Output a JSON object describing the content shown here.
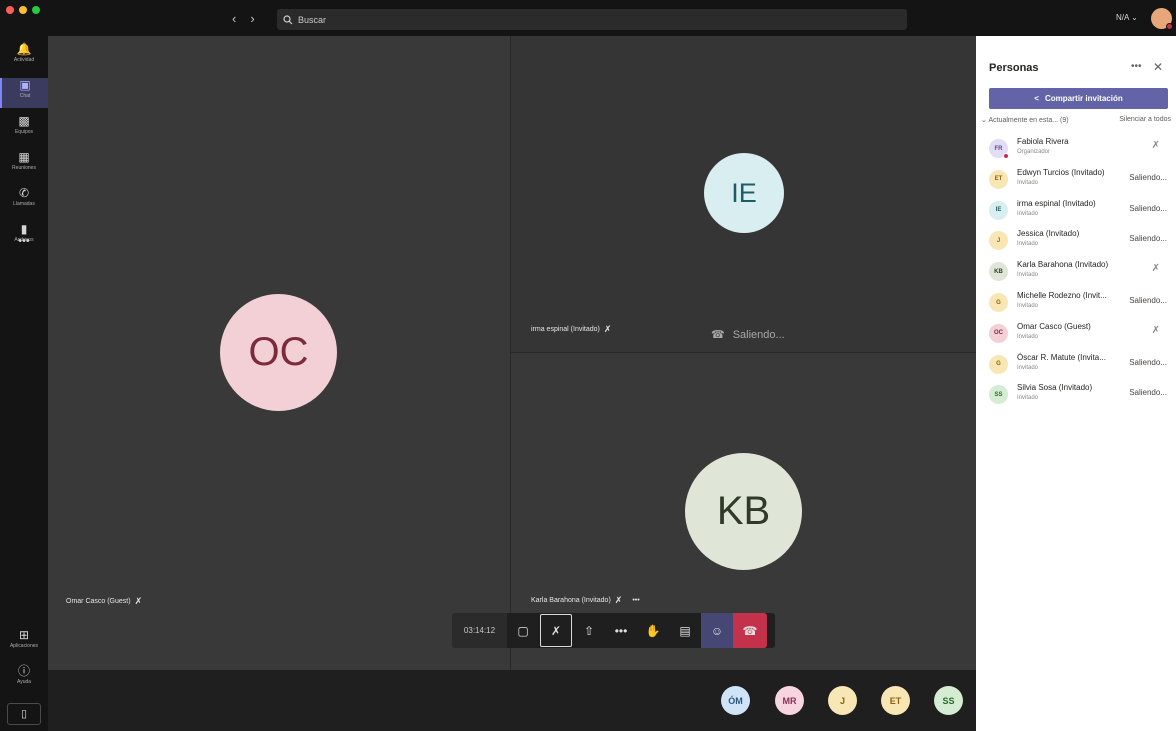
{
  "titlebar": {
    "back_icon": "chevron-left-icon",
    "forward_icon": "chevron-right-icon",
    "search_placeholder": "Buscar",
    "user_menu": "N/A ⌄"
  },
  "rail": {
    "items": [
      {
        "label": "Actividad",
        "icon": "bell-icon"
      },
      {
        "label": "Chat",
        "icon": "chat-icon"
      },
      {
        "label": "Equipos",
        "icon": "teams-icon"
      },
      {
        "label": "Reuniones",
        "icon": "calendar-icon"
      },
      {
        "label": "Llamadas",
        "icon": "phone-icon"
      },
      {
        "label": "Archivos",
        "icon": "file-icon"
      }
    ],
    "more": "•••",
    "apps_label": "Aplicaciones",
    "help_label": "Ayuda"
  },
  "stage": {
    "tiles": [
      {
        "initials": "OC",
        "label": "Omar Casco (Guest)"
      },
      {
        "initials": "IE",
        "label": "irma espinal (Invitado)"
      },
      {
        "initials": "KB",
        "label": "Karla Barahona (Invitado)"
      }
    ],
    "leaving_text": "Saliendo...",
    "more_label": "•••",
    "strip": [
      "ÓM",
      "MR",
      "J",
      "ET",
      "SS"
    ]
  },
  "controls": {
    "timer": "03:14:12",
    "more": "•••"
  },
  "panel": {
    "title": "Personas",
    "more": "•••",
    "close": "✕",
    "share_label": "Compartir invitación",
    "section_label": "Actualmente en esta... (9)",
    "mute_all": "Silenciar a todos",
    "people": [
      {
        "initials": "FR",
        "name": "Fabiola Rivera",
        "role": "Organizador",
        "status": "",
        "muted": true
      },
      {
        "initials": "ET",
        "name": "Edwyn Turcios (Invitado)",
        "role": "Invitado",
        "status": "Saliendo...",
        "muted": false
      },
      {
        "initials": "IE",
        "name": "irma espinal (Invitado)",
        "role": "Invitado",
        "status": "Saliendo...",
        "muted": false
      },
      {
        "initials": "J",
        "name": "Jessica (Invitado)",
        "role": "Invitado",
        "status": "Saliendo...",
        "muted": false
      },
      {
        "initials": "KB",
        "name": "Karla Barahona (Invitado)",
        "role": "Invitado",
        "status": "",
        "muted": true
      },
      {
        "initials": "G",
        "name": "Michelle Rodezno (Invit...",
        "role": "Invitado",
        "status": "Saliendo...",
        "muted": false
      },
      {
        "initials": "OC",
        "name": "Omar Casco (Guest)",
        "role": "Invitado",
        "status": "",
        "muted": true
      },
      {
        "initials": "G",
        "name": "Óscar R. Matute (Invita...",
        "role": "Invitado",
        "status": "Saliendo...",
        "muted": false
      },
      {
        "initials": "SS",
        "name": "Silvia Sosa (Invitado)",
        "role": "Invitado",
        "status": "Saliendo...",
        "muted": false
      }
    ]
  },
  "colors": {
    "accent": "#6264a7",
    "hangup": "#c4314b",
    "oc_bg": "#f2d0d6",
    "oc_fg": "#7a2b3c",
    "ie_bg": "#d8eef1",
    "ie_fg": "#1f5d66",
    "kb_bg": "#dfe6d8",
    "kb_fg": "#2f3b28"
  }
}
